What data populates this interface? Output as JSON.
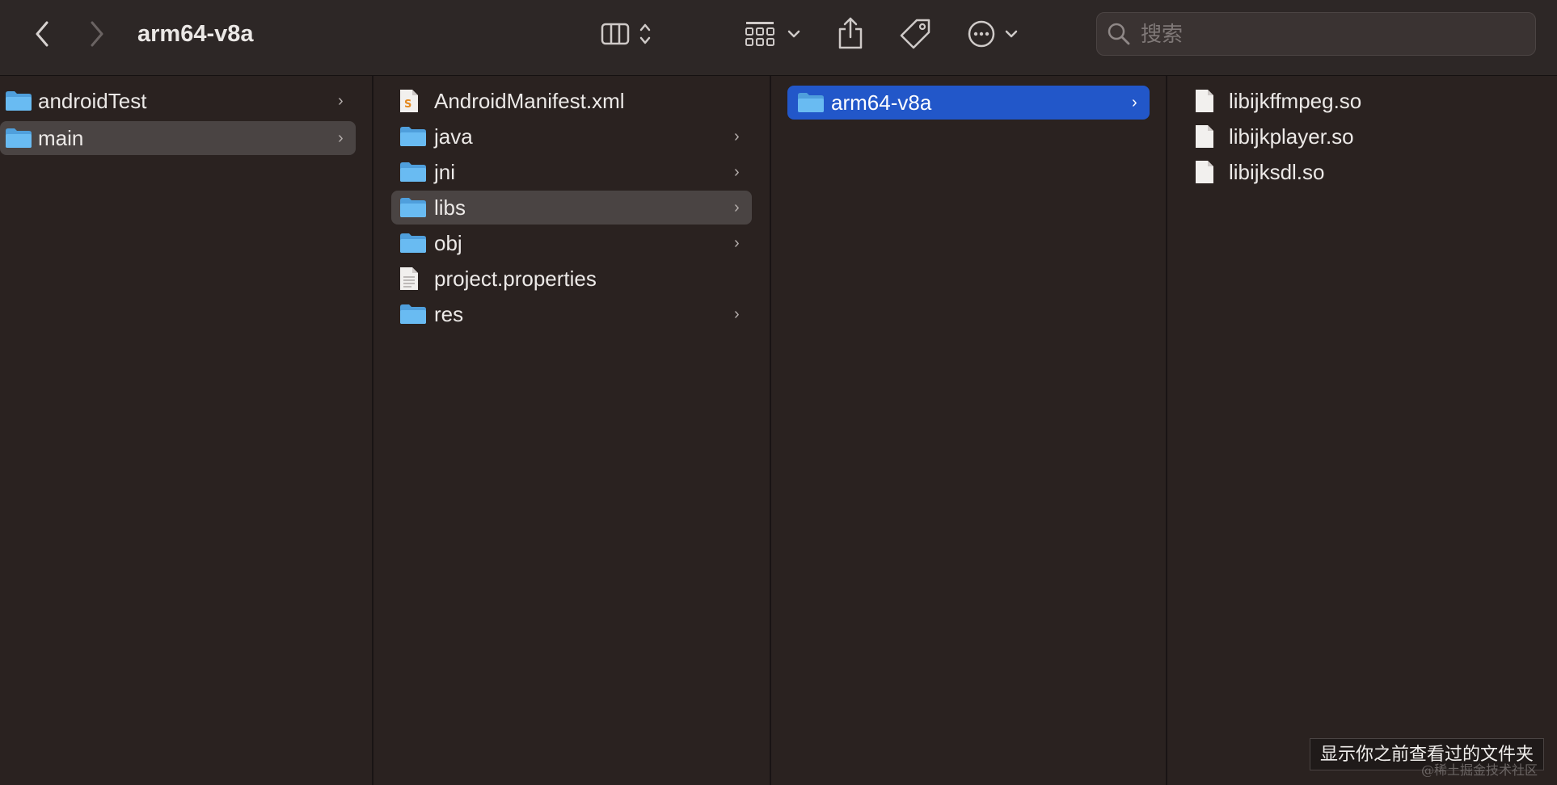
{
  "window": {
    "title": "arm64-v8a"
  },
  "toolbar": {
    "back_icon": "chevron-left-icon",
    "forward_icon": "chevron-right-icon",
    "view_icon": "column-view-icon",
    "group_icon": "grid-icon",
    "share_icon": "share-icon",
    "tag_icon": "tag-icon",
    "more_icon": "ellipsis-circle-icon"
  },
  "search": {
    "placeholder": "搜索"
  },
  "columns": [
    {
      "items": [
        {
          "name": "androidTest",
          "kind": "folder",
          "chevron": "›"
        },
        {
          "name": "main",
          "kind": "folder",
          "chevron": "›",
          "selected": "inactive"
        }
      ]
    },
    {
      "items": [
        {
          "name": "AndroidManifest.xml",
          "kind": "xml-file"
        },
        {
          "name": "java",
          "kind": "folder",
          "chevron": "›"
        },
        {
          "name": "jni",
          "kind": "folder",
          "chevron": "›"
        },
        {
          "name": "libs",
          "kind": "folder",
          "chevron": "›",
          "selected": "inactive"
        },
        {
          "name": "obj",
          "kind": "folder",
          "chevron": "›"
        },
        {
          "name": "project.properties",
          "kind": "text-file"
        },
        {
          "name": "res",
          "kind": "folder",
          "chevron": "›"
        }
      ]
    },
    {
      "items": [
        {
          "name": "arm64-v8a",
          "kind": "folder",
          "chevron": "›",
          "selected": "active"
        }
      ]
    },
    {
      "items": [
        {
          "name": "libijkffmpeg.so",
          "kind": "file"
        },
        {
          "name": "libijkplayer.so",
          "kind": "file"
        },
        {
          "name": "libijksdl.so",
          "kind": "file"
        }
      ]
    }
  ],
  "tooltip": {
    "text": "显示你之前查看过的文件夹"
  },
  "watermark": {
    "text": "@稀土掘金技术社区"
  },
  "colors": {
    "folder": "#5fb4f0",
    "selection_active": "#2257c9",
    "selection_inactive": "#4a4443",
    "background": "#2a2220"
  }
}
